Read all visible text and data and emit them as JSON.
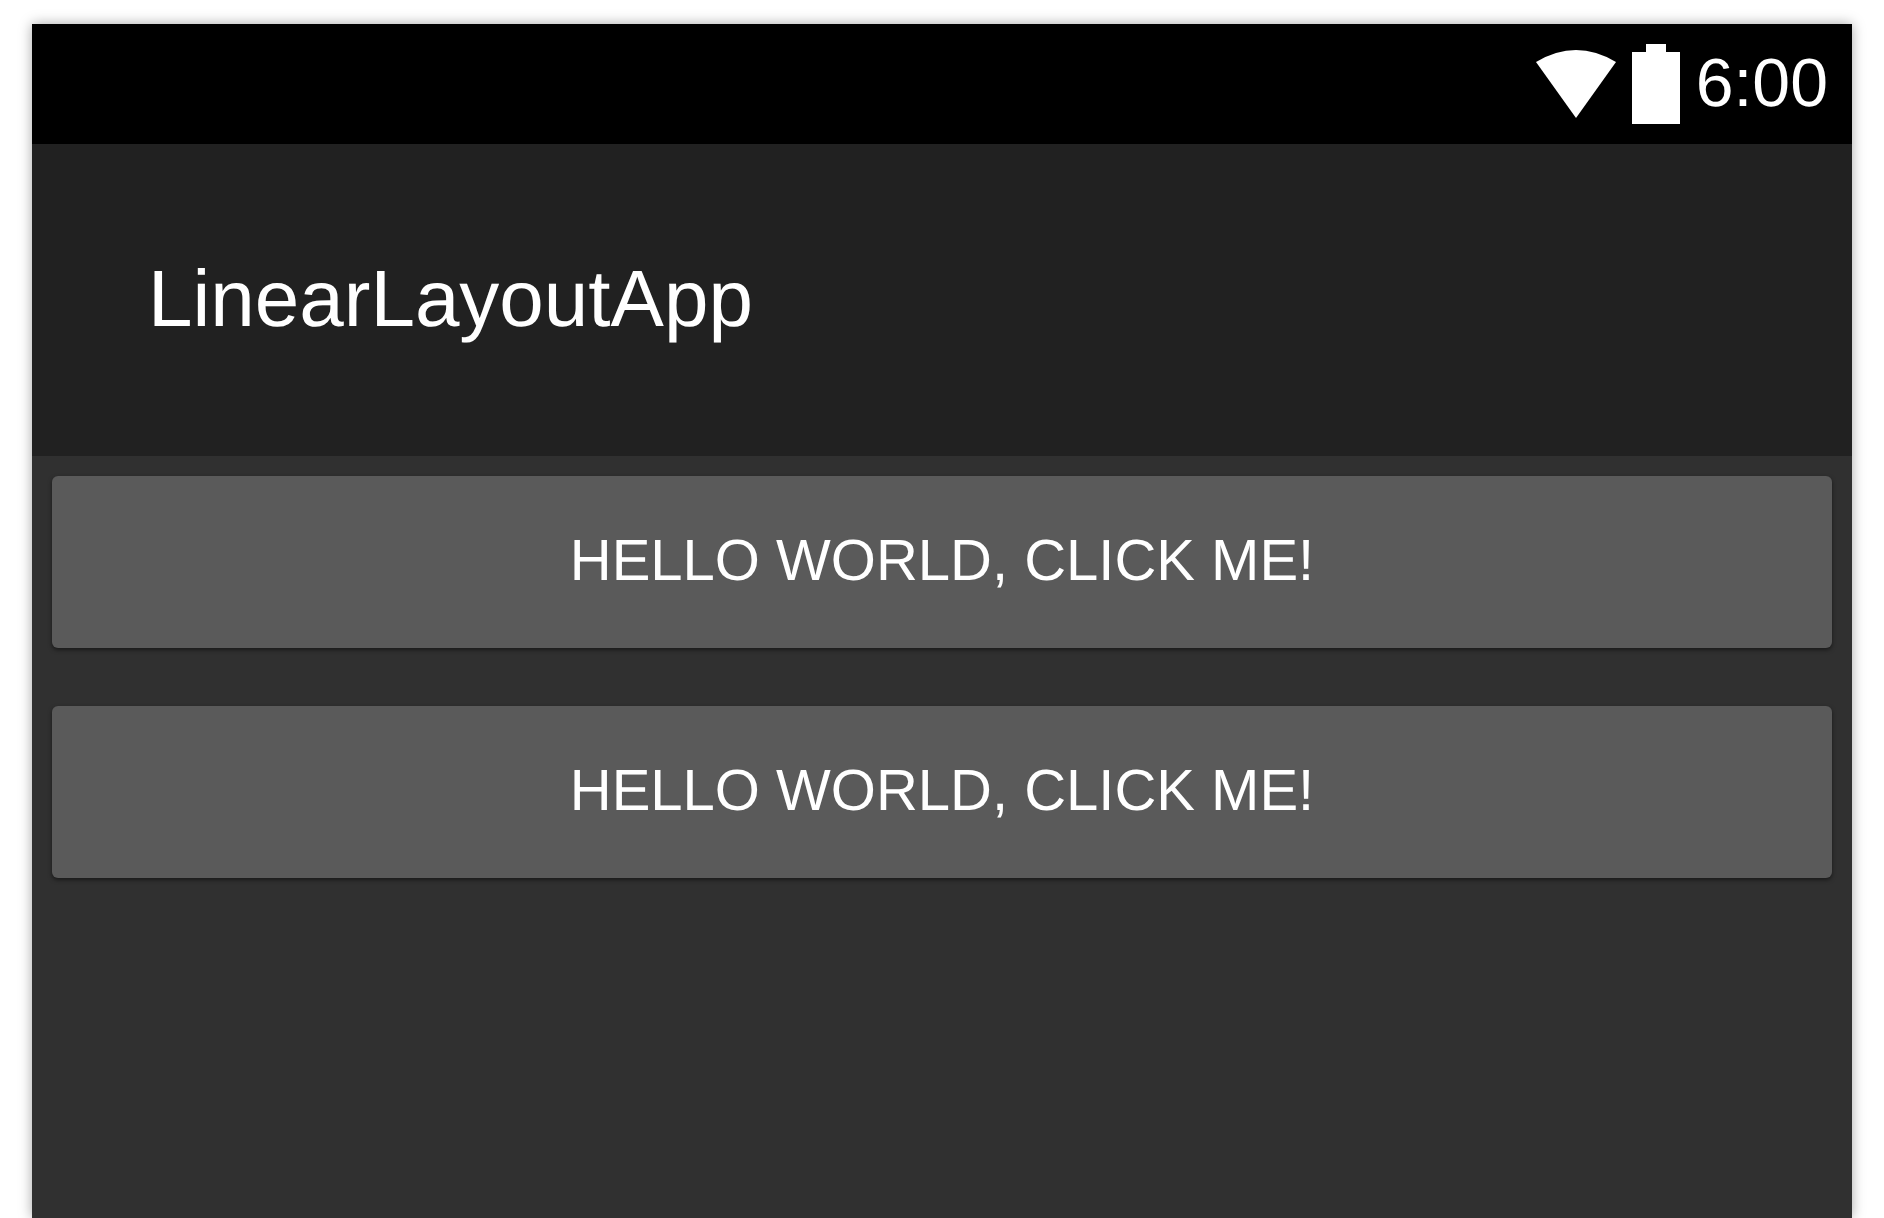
{
  "status_bar": {
    "time": "6:00"
  },
  "app_bar": {
    "title": "LinearLayoutApp"
  },
  "buttons": [
    {
      "label": "HELLO WORLD, CLICK ME!"
    },
    {
      "label": "HELLO WORLD, CLICK ME!"
    }
  ]
}
